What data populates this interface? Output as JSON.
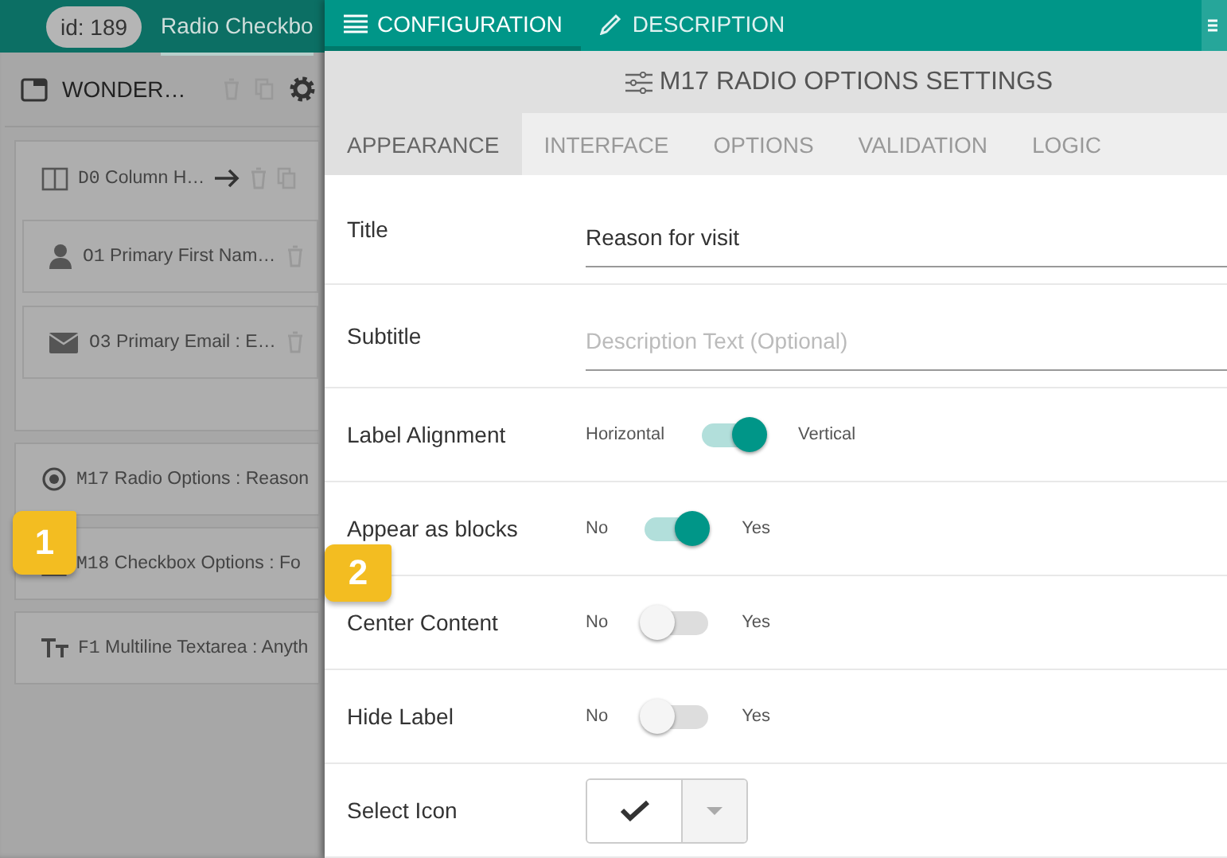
{
  "top_bar": {
    "id_badge": "id: 189",
    "tab": "Radio Checkbo"
  },
  "form_panel": {
    "title": "WONDER…",
    "deletable": true,
    "copyable": true,
    "configurable": true
  },
  "fields": [
    {
      "code": "D0",
      "label": "Column H…",
      "kind": "column",
      "movable": true,
      "deletable": true,
      "copyable": true,
      "children": [
        {
          "code": "O1",
          "label": "Primary First Nam…",
          "kind": "person",
          "deletable": true
        },
        {
          "code": "O3",
          "label": "Primary Email : E…",
          "kind": "email",
          "deletable": true
        }
      ]
    },
    {
      "code": "M17",
      "label": "Radio Options : Reason",
      "kind": "radio"
    },
    {
      "code": "M18",
      "label": "Checkbox Options : Fo",
      "kind": "checkbox"
    },
    {
      "code": "F1",
      "label": "Multiline Textarea : Anyth",
      "kind": "text"
    }
  ],
  "callouts": [
    "1",
    "2"
  ],
  "settings_tabs": [
    {
      "label": "CONFIGURATION",
      "selected": true,
      "kind": "config"
    },
    {
      "label": "DESCRIPTION",
      "selected": false,
      "kind": "description"
    }
  ],
  "settings_title": "M17 RADIO OPTIONS SETTINGS",
  "section_tabs": [
    {
      "label": "APPEARANCE",
      "selected": true
    },
    {
      "label": "INTERFACE",
      "selected": false
    },
    {
      "label": "OPTIONS",
      "selected": false
    },
    {
      "label": "VALIDATION",
      "selected": false
    },
    {
      "label": "LOGIC",
      "selected": false
    }
  ],
  "rows": [
    {
      "kind": "text",
      "label": "Title",
      "value": "Reason for visit"
    },
    {
      "kind": "text",
      "label": "Subtitle",
      "placeholder": "Description Text (Optional)"
    },
    {
      "kind": "toggle",
      "label": "Label Alignment",
      "off_label": "Horizontal",
      "on_label": "Vertical",
      "on": true
    },
    {
      "kind": "toggle",
      "label": "Appear as blocks",
      "off_label": "No",
      "on_label": "Yes",
      "on": true
    },
    {
      "kind": "toggle",
      "label": "Center Content",
      "off_label": "No",
      "on_label": "Yes",
      "on": false
    },
    {
      "kind": "toggle",
      "label": "Hide Label",
      "off_label": "No",
      "on_label": "Yes",
      "on": false
    },
    {
      "kind": "icon_select",
      "label": "Select Icon"
    }
  ]
}
